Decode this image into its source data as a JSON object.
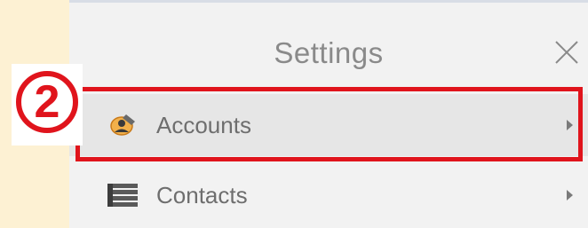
{
  "panel": {
    "title": "Settings",
    "close_icon": "close-icon"
  },
  "menu": {
    "items": [
      {
        "label": "Accounts",
        "icon": "accounts-icon",
        "chevron": "chevron-right-icon",
        "highlighted": true
      },
      {
        "label": "Contacts",
        "icon": "contacts-icon",
        "chevron": "chevron-right-icon",
        "highlighted": false
      }
    ]
  },
  "annotation": {
    "step_number": "2",
    "color": "#e0141c"
  },
  "colors": {
    "page_background": "#fdf1d3",
    "panel_background": "#f2f2f2",
    "selected_row": "#e6e6e6",
    "text": "#6e6e6e"
  }
}
